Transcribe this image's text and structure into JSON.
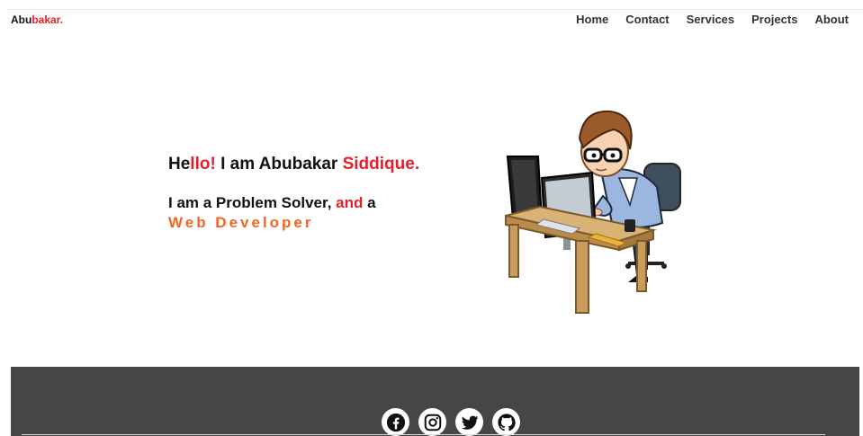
{
  "brand": {
    "part1": "Abu",
    "part2": "bakar",
    "dot": "."
  },
  "nav": {
    "items": [
      {
        "label": "Home"
      },
      {
        "label": "Contact"
      },
      {
        "label": "Services"
      },
      {
        "label": "Projects"
      },
      {
        "label": "About"
      }
    ]
  },
  "hero": {
    "hello_he": "He",
    "hello_llo": "llo!",
    "hello_mid": " I am Abubakar ",
    "hello_last": "Siddique.",
    "tag_start": "I am a Problem Solver, ",
    "tag_and": "and",
    "tag_end": " a",
    "role": "Web Developer"
  },
  "footer": {
    "socials": [
      {
        "icon": "facebook-icon"
      },
      {
        "icon": "instagram-icon"
      },
      {
        "icon": "twitter-icon"
      },
      {
        "icon": "github-icon"
      }
    ]
  },
  "colors": {
    "accent_red": "#e3202a",
    "accent_orange": "#f26522",
    "footer_bg": "#464646"
  }
}
